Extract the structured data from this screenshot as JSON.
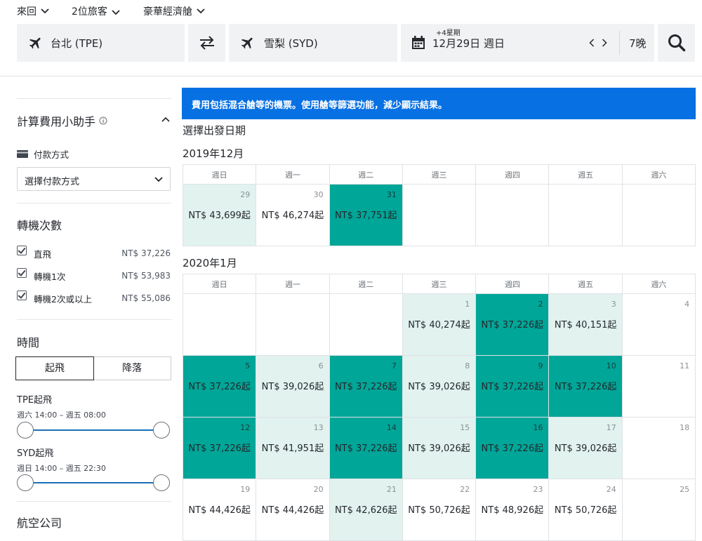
{
  "top_options": {
    "trip_type": "來回",
    "travellers": "2位旅客",
    "cabin": "豪華經濟艙"
  },
  "search": {
    "origin": "台北 (TPE)",
    "destination": "雪梨 (SYD)",
    "date_sub": "+4星期",
    "date_main": "12月29日 週日",
    "nights": "7晚"
  },
  "sidebar": {
    "calc_title": "計算費用小助手",
    "payment_label": "付款方式",
    "payment_select": "選擇付款方式",
    "stops_title": "轉機次數",
    "stops": [
      {
        "label": "直飛",
        "price": "NT$ 37,226"
      },
      {
        "label": "轉機1次",
        "price": "NT$ 53,983"
      },
      {
        "label": "轉機2次或以上",
        "price": "NT$ 55,086"
      }
    ],
    "time_title": "時間",
    "tab_depart": "起飛",
    "tab_arrive": "降落",
    "tpe_label": "TPE起飛",
    "tpe_range": "週六 14:00 – 週五 08:00",
    "syd_label": "SYD起飛",
    "syd_range": "週日 14:00 – 週五 22:30",
    "airline_title": "航空公司"
  },
  "banner_text": "費用包括混合艙等的機票。使用艙等篩選功能，減少顯示結果。",
  "select_date_title": "選擇出發日期",
  "weekdays": [
    "週日",
    "週一",
    "週二",
    "週三",
    "週四",
    "週五",
    "週六"
  ],
  "months": [
    {
      "title": "2019年12月",
      "weeks": [
        [
          {
            "day": "29",
            "price": "NT$ 43,699起",
            "tone": "light"
          },
          {
            "day": "30",
            "price": "NT$ 46,274起",
            "tone": "white"
          },
          {
            "day": "31",
            "price": "NT$ 37,751起",
            "tone": "green"
          },
          {
            "day": "",
            "price": "",
            "tone": "white"
          },
          {
            "day": "",
            "price": "",
            "tone": "white"
          },
          {
            "day": "",
            "price": "",
            "tone": "white"
          },
          {
            "day": "",
            "price": "",
            "tone": "white"
          }
        ]
      ]
    },
    {
      "title": "2020年1月",
      "weeks": [
        [
          {
            "day": "",
            "price": "",
            "tone": "white"
          },
          {
            "day": "",
            "price": "",
            "tone": "white"
          },
          {
            "day": "",
            "price": "",
            "tone": "white"
          },
          {
            "day": "1",
            "price": "NT$ 40,274起",
            "tone": "light"
          },
          {
            "day": "2",
            "price": "NT$ 37,226起",
            "tone": "green"
          },
          {
            "day": "3",
            "price": "NT$ 40,151起",
            "tone": "light"
          },
          {
            "day": "4",
            "price": "",
            "tone": "white"
          }
        ],
        [
          {
            "day": "5",
            "price": "NT$ 37,226起",
            "tone": "green"
          },
          {
            "day": "6",
            "price": "NT$ 39,026起",
            "tone": "light"
          },
          {
            "day": "7",
            "price": "NT$ 37,226起",
            "tone": "green"
          },
          {
            "day": "8",
            "price": "NT$ 39,026起",
            "tone": "light"
          },
          {
            "day": "9",
            "price": "NT$ 37,226起",
            "tone": "green"
          },
          {
            "day": "10",
            "price": "NT$ 37,226起",
            "tone": "green"
          },
          {
            "day": "11",
            "price": "",
            "tone": "white"
          }
        ],
        [
          {
            "day": "12",
            "price": "NT$ 37,226起",
            "tone": "green"
          },
          {
            "day": "13",
            "price": "NT$ 41,951起",
            "tone": "light"
          },
          {
            "day": "14",
            "price": "NT$ 37,226起",
            "tone": "green"
          },
          {
            "day": "15",
            "price": "NT$ 39,026起",
            "tone": "light"
          },
          {
            "day": "16",
            "price": "NT$ 37,226起",
            "tone": "green"
          },
          {
            "day": "17",
            "price": "NT$ 39,026起",
            "tone": "light"
          },
          {
            "day": "18",
            "price": "",
            "tone": "white"
          }
        ],
        [
          {
            "day": "19",
            "price": "NT$ 44,426起",
            "tone": "white"
          },
          {
            "day": "20",
            "price": "NT$ 44,426起",
            "tone": "white"
          },
          {
            "day": "21",
            "price": "NT$ 42,626起",
            "tone": "light"
          },
          {
            "day": "22",
            "price": "NT$ 50,726起",
            "tone": "white"
          },
          {
            "day": "23",
            "price": "NT$ 48,926起",
            "tone": "white"
          },
          {
            "day": "24",
            "price": "NT$ 50,726起",
            "tone": "white"
          },
          {
            "day": "25",
            "price": "",
            "tone": "white"
          }
        ]
      ]
    }
  ],
  "colors": {
    "green": "#00a698",
    "light": "#e1f2ef",
    "banner": "#0770e3"
  },
  "icons": [
    "chevron-down-icon",
    "plane-icon",
    "swap-icon",
    "calendar-icon",
    "chevron-left-icon",
    "chevron-right-icon",
    "search-icon",
    "info-icon",
    "chevron-up-icon",
    "card-icon",
    "checkbox-icon"
  ]
}
